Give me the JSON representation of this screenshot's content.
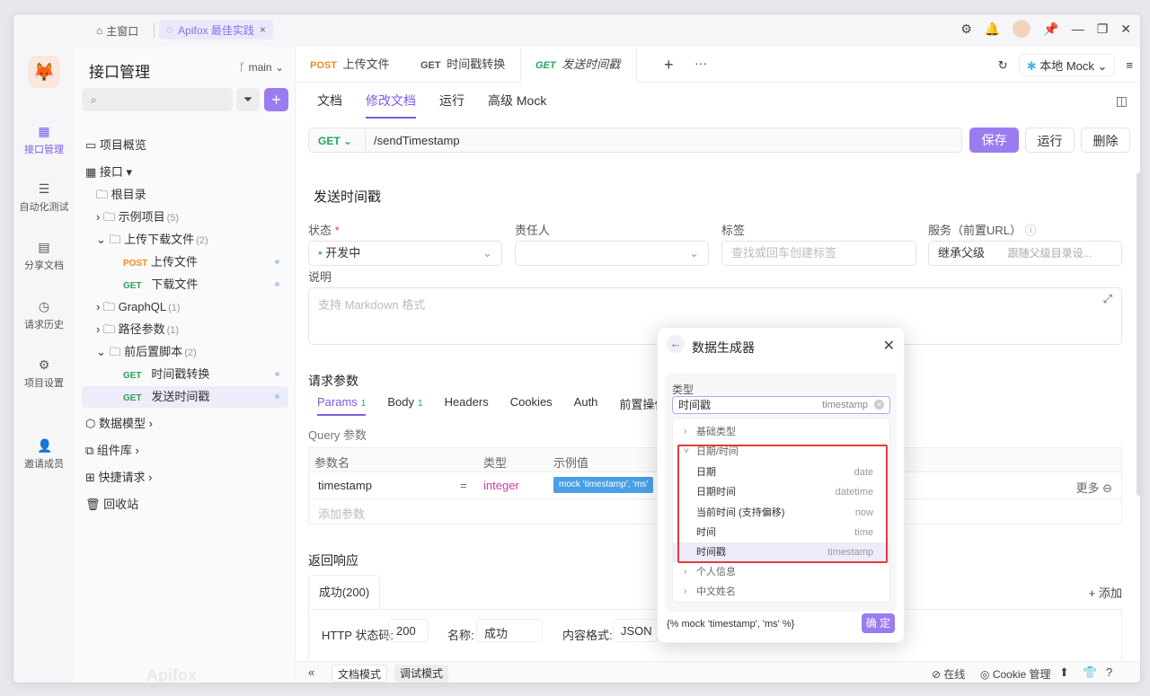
{
  "titlebar": {
    "home": "主窗口",
    "workspace": "Apifox 最佳实践",
    "close": "×"
  },
  "leftnav": [
    {
      "label": "接口管理",
      "icon": "api-icon"
    },
    {
      "label": "自动化测试",
      "icon": "layers-icon"
    },
    {
      "label": "分享文档",
      "icon": "share-doc-icon"
    },
    {
      "label": "请求历史",
      "icon": "history-icon"
    },
    {
      "label": "项目设置",
      "icon": "settings-icon"
    },
    {
      "label": "邀请成员",
      "icon": "invite-icon"
    }
  ],
  "sidebar": {
    "title": "接口管理",
    "branch": "main",
    "items": [
      {
        "label": "项目概览"
      },
      {
        "label": "接口"
      },
      {
        "label": "根目录"
      },
      {
        "label": "示例项目",
        "count": "(5)"
      },
      {
        "label": "上传下载文件",
        "count": "(2)"
      },
      {
        "method": "POST",
        "label": "上传文件"
      },
      {
        "method": "GET",
        "label": "下载文件"
      },
      {
        "label": "GraphQL",
        "count": "(1)"
      },
      {
        "label": "路径参数",
        "count": "(1)"
      },
      {
        "label": "前后置脚本",
        "count": "(2)"
      },
      {
        "method": "GET",
        "label": "时间戳转换"
      },
      {
        "method": "GET",
        "label": "发送时间戳"
      },
      {
        "label": "数据模型"
      },
      {
        "label": "组件库"
      },
      {
        "label": "快捷请求"
      },
      {
        "label": "回收站"
      }
    ],
    "watermark": "Apifox"
  },
  "tabs": [
    {
      "method": "POST",
      "label": "上传文件"
    },
    {
      "method": "GET",
      "label": "时间戳转换"
    },
    {
      "method": "GET",
      "label": "发送时间戳"
    }
  ],
  "env": {
    "label": "本地 Mock"
  },
  "subtabs": [
    "文档",
    "修改文档",
    "运行",
    "高级 Mock"
  ],
  "request": {
    "method": "GET",
    "path": "/sendTimestamp",
    "save": "保存",
    "run": "运行",
    "delete": "删除"
  },
  "form": {
    "name": "发送时间戳",
    "status_label": "状态",
    "status_value": "开发中",
    "owner_label": "责任人",
    "tags_label": "标签",
    "tags_placeholder": "查找或回车创建标签",
    "service_label": "服务（前置URL）",
    "service_value": "继承父级",
    "service_hint": "跟随父级目录设...",
    "desc_label": "说明",
    "desc_placeholder": "支持 Markdown 格式"
  },
  "params": {
    "section": "请求参数",
    "tabs": [
      {
        "label": "Params",
        "badge": "1"
      },
      {
        "label": "Body",
        "badge": "1"
      },
      {
        "label": "Headers"
      },
      {
        "label": "Cookies"
      },
      {
        "label": "Auth"
      },
      {
        "label": "前置操作"
      }
    ],
    "query_label": "Query 参数",
    "headers": [
      "参数名",
      "类型",
      "示例值"
    ],
    "row": {
      "name": "timestamp",
      "eq": "=",
      "type": "integer",
      "example": "mock 'timestamp', 'ms'"
    },
    "add_placeholder": "添加参数",
    "more": "更多"
  },
  "response": {
    "section": "返回响应",
    "tab": "成功(200)",
    "add": "+ 添加",
    "http_status_label": "HTTP 状态码:",
    "http_status_value": "200",
    "name_label": "名称:",
    "name_value": "成功",
    "content_label": "内容格式:",
    "content_value": "JSON"
  },
  "statusbar": {
    "doc_mode": "文档模式",
    "debug_mode": "调试模式",
    "online": "在线",
    "cookie": "Cookie 管理"
  },
  "dialog": {
    "title": "数据生成器",
    "type_label": "类型",
    "input_value": "时间戳",
    "input_right": "timestamp",
    "rows": [
      {
        "cat": true,
        "label": "基础类型",
        "car": "›"
      },
      {
        "cat": true,
        "label": "日期/时间",
        "car": "˅"
      },
      {
        "label": "日期",
        "key": "date"
      },
      {
        "label": "日期时间",
        "key": "datetime"
      },
      {
        "label": "当前时间 (支持偏移)",
        "key": "now"
      },
      {
        "label": "时间",
        "key": "time"
      },
      {
        "label": "时间戳",
        "key": "timestamp"
      },
      {
        "cat": true,
        "label": "个人信息",
        "car": "›"
      },
      {
        "cat": true,
        "label": "中文姓名",
        "car": "›"
      }
    ],
    "footer": "{% mock 'timestamp', 'ms' %}",
    "ok": "确 定"
  }
}
